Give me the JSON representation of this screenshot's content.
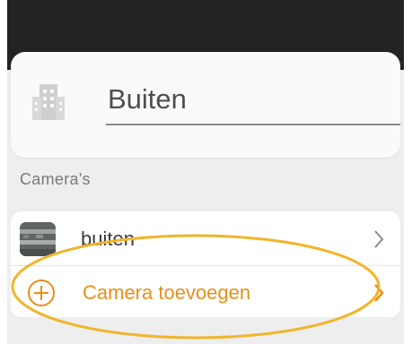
{
  "location": {
    "name_value": "Buiten"
  },
  "cameras": {
    "section_label": "Camera's",
    "items": [
      {
        "label": "buiten"
      }
    ],
    "add_label": "Camera toevoegen"
  },
  "colors": {
    "accent": "#e88f1b",
    "highlight_ellipse": "#f0b52a",
    "topbar": "#232323",
    "background": "#eeeeee"
  },
  "icons": {
    "building": "building-icon",
    "camera_thumbnail": "camera-thumbnail",
    "add": "plus-circle-icon",
    "chevron": "chevron-right-icon"
  }
}
